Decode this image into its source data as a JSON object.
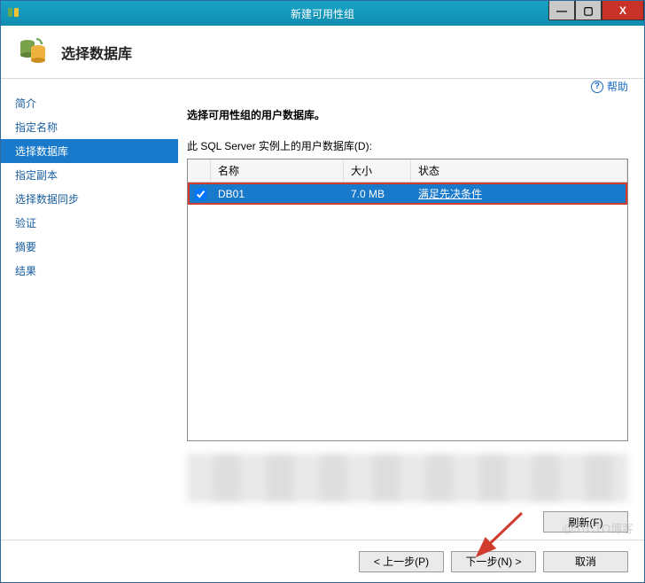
{
  "window": {
    "title": "新建可用性组",
    "minimize": "—",
    "maximize": "▢",
    "close": "X"
  },
  "header": {
    "title": "选择数据库"
  },
  "sidebar": {
    "items": [
      {
        "label": "简介"
      },
      {
        "label": "指定名称"
      },
      {
        "label": "选择数据库"
      },
      {
        "label": "指定副本"
      },
      {
        "label": "选择数据同步"
      },
      {
        "label": "验证"
      },
      {
        "label": "摘要"
      },
      {
        "label": "结果"
      }
    ],
    "active_index": 2
  },
  "main": {
    "help_label": "帮助",
    "instruction": "选择可用性组的用户数据库。",
    "list_label": "此 SQL Server 实例上的用户数据库(D):",
    "columns": {
      "name": "名称",
      "size": "大小",
      "status": "状态"
    },
    "rows": [
      {
        "checked": true,
        "name": "DB01",
        "size": "7.0 MB",
        "status": "满足先决条件"
      }
    ],
    "refresh_label": "刷新(F)"
  },
  "footer": {
    "prev": "< 上一步(P)",
    "next": "下一步(N) >",
    "cancel": "取消"
  },
  "watermark": "@51CTO博客"
}
